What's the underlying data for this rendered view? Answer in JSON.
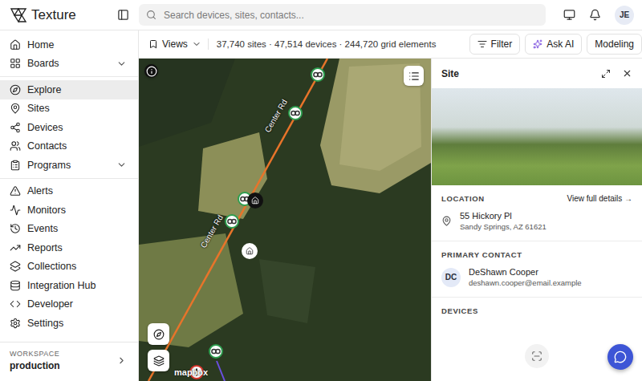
{
  "app": {
    "name": "Texture"
  },
  "search": {
    "placeholder": "Search devices, sites, contacts..."
  },
  "user": {
    "initials": "JE"
  },
  "sidebar": {
    "groups": [
      [
        {
          "label": "Home",
          "selected": false,
          "expandable": false
        },
        {
          "label": "Boards",
          "selected": false,
          "expandable": true
        }
      ],
      [
        {
          "label": "Explore",
          "selected": true,
          "expandable": false
        },
        {
          "label": "Sites",
          "selected": false,
          "expandable": false
        },
        {
          "label": "Devices",
          "selected": false,
          "expandable": false
        },
        {
          "label": "Contacts",
          "selected": false,
          "expandable": false
        },
        {
          "label": "Programs",
          "selected": false,
          "expandable": true
        }
      ],
      [
        {
          "label": "Alerts",
          "selected": false,
          "expandable": false
        },
        {
          "label": "Monitors",
          "selected": false,
          "expandable": false
        },
        {
          "label": "Events",
          "selected": false,
          "expandable": false
        },
        {
          "label": "Reports",
          "selected": false,
          "expandable": false
        },
        {
          "label": "Collections",
          "selected": false,
          "expandable": false
        }
      ],
      [
        {
          "label": "Integration Hub",
          "selected": false,
          "expandable": false
        },
        {
          "label": "Developer",
          "selected": false,
          "expandable": false
        },
        {
          "label": "Settings",
          "selected": false,
          "expandable": false
        }
      ]
    ],
    "workspace": {
      "label": "WORKSPACE",
      "value": "production"
    }
  },
  "toolbar": {
    "views": "Views",
    "summary": "37,740 sites · 47,514 devices · 244,720 grid elements",
    "buttons": [
      "Filter",
      "Ask AI",
      "Modeling"
    ]
  },
  "map": {
    "road_labels": [
      "Center Rd",
      "Center Rd"
    ],
    "attribution": "mapbox",
    "pins": [
      {
        "kind": "device",
        "selected": false,
        "color": "#2e9e4f"
      },
      {
        "kind": "device",
        "selected": false,
        "color": "#2e9e4f"
      },
      {
        "kind": "device",
        "selected": false,
        "color": "#2e9e4f"
      },
      {
        "kind": "site",
        "selected": true,
        "color": "#111111"
      },
      {
        "kind": "device",
        "selected": false,
        "color": "#2e9e4f"
      },
      {
        "kind": "site",
        "selected": false,
        "color": "#ffffff"
      },
      {
        "kind": "device",
        "selected": false,
        "color": "#2e9e4f"
      },
      {
        "kind": "alert",
        "selected": false,
        "color": "#d9342b"
      }
    ]
  },
  "panel": {
    "title": "Site",
    "location": {
      "heading": "LOCATION",
      "link": "View full details →",
      "address": "55 Hickory Pl",
      "city": "Sandy Springs, AZ 61621"
    },
    "contact": {
      "heading": "PRIMARY CONTACT",
      "initials": "DC",
      "name": "DeShawn Cooper",
      "email": "deshawn.cooper@email.example"
    },
    "devices": {
      "heading": "DEVICES"
    }
  }
}
